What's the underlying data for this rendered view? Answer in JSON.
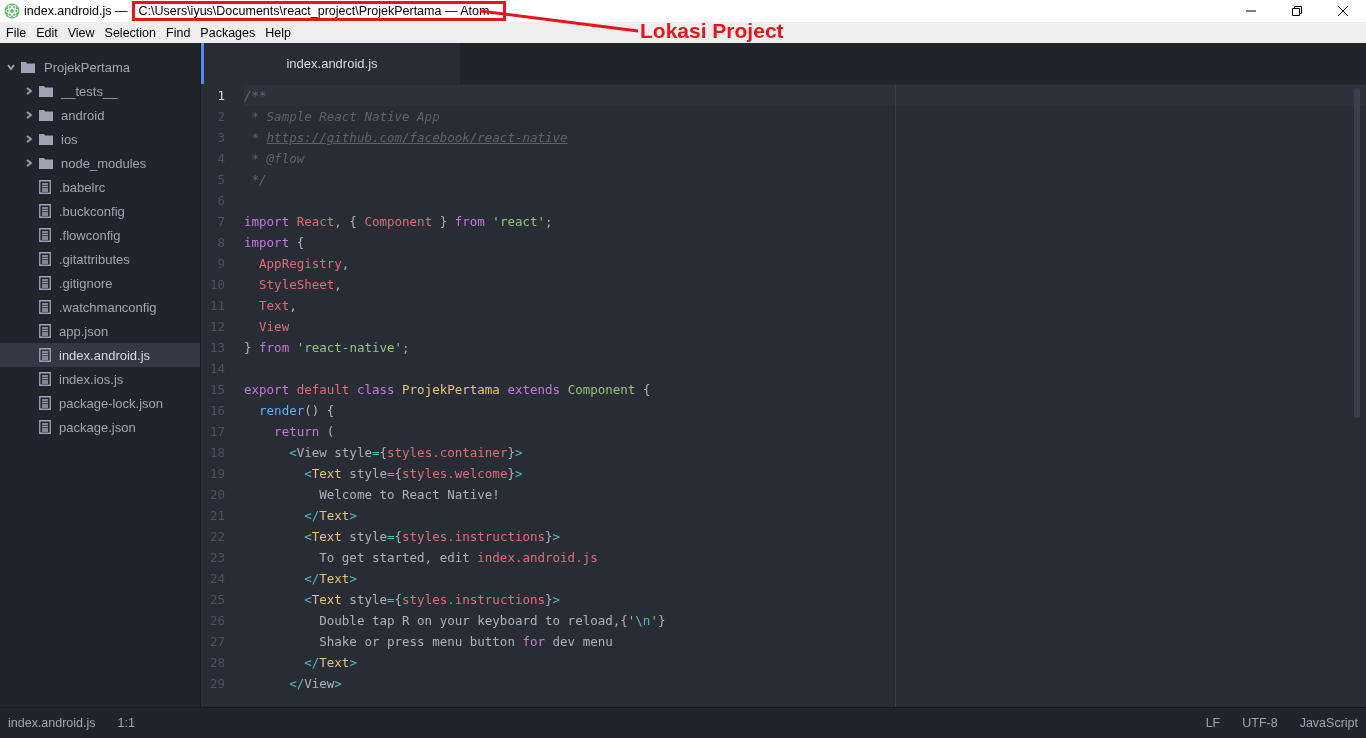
{
  "window": {
    "file_title": "index.android.js —",
    "path_title": "C:\\Users\\iyus\\Documents\\react_project\\ProjekPertama — Atom"
  },
  "annotation": {
    "label": "Lokasi Project"
  },
  "menu": [
    "File",
    "Edit",
    "View",
    "Selection",
    "Find",
    "Packages",
    "Help"
  ],
  "tree": {
    "name": "ProjekPertama",
    "expanded": true,
    "children": [
      {
        "name": "__tests__",
        "kind": "folder",
        "expanded": false,
        "selected": false
      },
      {
        "name": "android",
        "kind": "folder",
        "expanded": false,
        "selected": false
      },
      {
        "name": "ios",
        "kind": "folder",
        "expanded": false,
        "selected": false
      },
      {
        "name": "node_modules",
        "kind": "folder",
        "expanded": false,
        "selected": false
      },
      {
        "name": ".babelrc",
        "kind": "file",
        "selected": false
      },
      {
        "name": ".buckconfig",
        "kind": "file",
        "selected": false
      },
      {
        "name": ".flowconfig",
        "kind": "file",
        "selected": false
      },
      {
        "name": ".gitattributes",
        "kind": "file",
        "selected": false
      },
      {
        "name": ".gitignore",
        "kind": "file",
        "selected": false
      },
      {
        "name": ".watchmanconfig",
        "kind": "file",
        "selected": false
      },
      {
        "name": "app.json",
        "kind": "file",
        "selected": false
      },
      {
        "name": "index.android.js",
        "kind": "file",
        "selected": true
      },
      {
        "name": "index.ios.js",
        "kind": "file",
        "selected": false
      },
      {
        "name": "package-lock.json",
        "kind": "file",
        "selected": false
      },
      {
        "name": "package.json",
        "kind": "file",
        "selected": false
      }
    ]
  },
  "tabs": [
    {
      "label": "index.android.js",
      "selected": true
    }
  ],
  "code": [
    {
      "num": "1",
      "current": true,
      "tokens": [
        {
          "kind": "comment",
          "text": "/**"
        }
      ]
    },
    {
      "num": "2",
      "current": false,
      "tokens": [
        {
          "kind": "comment",
          "text": " * Sample React Native App"
        }
      ]
    },
    {
      "num": "3",
      "current": false,
      "tokens": [
        {
          "kind": "comment",
          "text": " * "
        },
        {
          "kind": "link",
          "text": "https://github.com/facebook/react-native"
        }
      ]
    },
    {
      "num": "4",
      "current": false,
      "tokens": [
        {
          "kind": "comment",
          "text": " * @flow"
        }
      ]
    },
    {
      "num": "5",
      "current": false,
      "tokens": [
        {
          "kind": "comment",
          "text": " */"
        }
      ]
    },
    {
      "num": "6",
      "current": false
    },
    {
      "num": "7",
      "current": false,
      "tokens": [
        {
          "kind": "keyword",
          "text": "import"
        },
        {
          "kind": "variable",
          "text": " React"
        },
        {
          "kind": "plain",
          "text": ", { "
        },
        {
          "kind": "variable",
          "text": "Component"
        },
        {
          "kind": "plain",
          "text": " } "
        },
        {
          "kind": "keyword",
          "text": "from"
        },
        {
          "kind": "string",
          "text": " 'react'"
        },
        {
          "kind": "plain",
          "text": ";"
        }
      ]
    },
    {
      "num": "8",
      "current": false,
      "tokens": [
        {
          "kind": "keyword",
          "text": "import"
        },
        {
          "kind": "plain",
          "text": " {"
        }
      ]
    },
    {
      "num": "9",
      "current": false,
      "tokens": [
        {
          "kind": "variable",
          "text": "  AppRegistry"
        },
        {
          "kind": "plain",
          "text": ","
        }
      ]
    },
    {
      "num": "10",
      "current": false,
      "tokens": [
        {
          "kind": "variable",
          "text": "  StyleSheet"
        },
        {
          "kind": "plain",
          "text": ","
        }
      ]
    },
    {
      "num": "11",
      "current": false,
      "tokens": [
        {
          "kind": "variable",
          "text": "  Text"
        },
        {
          "kind": "plain",
          "text": ","
        }
      ]
    },
    {
      "num": "12",
      "current": false,
      "tokens": [
        {
          "kind": "variable",
          "text": "  View"
        }
      ]
    },
    {
      "num": "13",
      "current": false,
      "tokens": [
        {
          "kind": "plain",
          "text": "} "
        },
        {
          "kind": "keyword",
          "text": "from"
        },
        {
          "kind": "string",
          "text": " 'react-native'"
        },
        {
          "kind": "plain",
          "text": ";"
        }
      ]
    },
    {
      "num": "14",
      "current": false
    },
    {
      "num": "15",
      "current": false,
      "tokens": [
        {
          "kind": "keyword",
          "text": "export"
        },
        {
          "kind": "variable",
          "text": " default"
        },
        {
          "kind": "keyword",
          "text": " class"
        },
        {
          "kind": "class",
          "text": " ProjekPertama"
        },
        {
          "kind": "keyword",
          "text": " extends"
        },
        {
          "kind": "string",
          "text": " Component"
        },
        {
          "kind": "plain",
          "text": " {"
        }
      ]
    },
    {
      "num": "16",
      "current": false,
      "tokens": [
        {
          "kind": "function",
          "text": "  render"
        },
        {
          "kind": "plain",
          "text": "() {"
        }
      ]
    },
    {
      "num": "17",
      "current": false,
      "tokens": [
        {
          "kind": "keyword",
          "text": "    return"
        },
        {
          "kind": "plain",
          "text": " ("
        }
      ]
    },
    {
      "num": "18",
      "current": false,
      "tokens": [
        {
          "kind": "punctuation",
          "text": "      <"
        },
        {
          "kind": "plain",
          "text": "View style"
        },
        {
          "kind": "punctuation",
          "text": "="
        },
        {
          "kind": "plain",
          "text": "{"
        },
        {
          "kind": "variable",
          "text": "styles.container"
        },
        {
          "kind": "plain",
          "text": "}"
        },
        {
          "kind": "punctuation",
          "text": ">"
        }
      ]
    },
    {
      "num": "19",
      "current": false,
      "tokens": [
        {
          "kind": "punctuation",
          "text": "        <"
        },
        {
          "kind": "class",
          "text": "Text"
        },
        {
          "kind": "plain",
          "text": " style"
        },
        {
          "kind": "punctuation",
          "text": "="
        },
        {
          "kind": "plain",
          "text": "{"
        },
        {
          "kind": "variable",
          "text": "styles.welcome"
        },
        {
          "kind": "plain",
          "text": "}"
        },
        {
          "kind": "punctuation",
          "text": ">"
        }
      ]
    },
    {
      "num": "20",
      "current": false,
      "tokens": [
        {
          "kind": "plain",
          "text": "          Welcome to React Native!"
        }
      ]
    },
    {
      "num": "21",
      "current": false,
      "tokens": [
        {
          "kind": "punctuation",
          "text": "        </"
        },
        {
          "kind": "class",
          "text": "Text"
        },
        {
          "kind": "punctuation",
          "text": ">"
        }
      ]
    },
    {
      "num": "22",
      "current": false,
      "tokens": [
        {
          "kind": "punctuation",
          "text": "        <"
        },
        {
          "kind": "class",
          "text": "Text"
        },
        {
          "kind": "plain",
          "text": " style"
        },
        {
          "kind": "punctuation",
          "text": "="
        },
        {
          "kind": "plain",
          "text": "{"
        },
        {
          "kind": "variable",
          "text": "styles.instructions"
        },
        {
          "kind": "plain",
          "text": "}"
        },
        {
          "kind": "punctuation",
          "text": ">"
        }
      ]
    },
    {
      "num": "23",
      "current": false,
      "tokens": [
        {
          "kind": "plain",
          "text": "          To get started, edit "
        },
        {
          "kind": "variable",
          "text": "index.android.js"
        }
      ]
    },
    {
      "num": "24",
      "current": false,
      "tokens": [
        {
          "kind": "punctuation",
          "text": "        </"
        },
        {
          "kind": "class",
          "text": "Text"
        },
        {
          "kind": "punctuation",
          "text": ">"
        }
      ]
    },
    {
      "num": "25",
      "current": false,
      "tokens": [
        {
          "kind": "punctuation",
          "text": "        <"
        },
        {
          "kind": "class",
          "text": "Text"
        },
        {
          "kind": "plain",
          "text": " style"
        },
        {
          "kind": "punctuation",
          "text": "="
        },
        {
          "kind": "plain",
          "text": "{"
        },
        {
          "kind": "variable",
          "text": "styles.instructions"
        },
        {
          "kind": "plain",
          "text": "}"
        },
        {
          "kind": "punctuation",
          "text": ">"
        }
      ]
    },
    {
      "num": "26",
      "current": false,
      "tokens": [
        {
          "kind": "plain",
          "text": "          Double tap R on your keyboard to reload,{"
        },
        {
          "kind": "string",
          "text": "'"
        },
        {
          "kind": "punctuation",
          "text": "\\n"
        },
        {
          "kind": "string",
          "text": "'"
        },
        {
          "kind": "plain",
          "text": "}"
        }
      ]
    },
    {
      "num": "27",
      "current": false,
      "tokens": [
        {
          "kind": "plain",
          "text": "          Shake or press menu button "
        },
        {
          "kind": "keyword",
          "text": "for"
        },
        {
          "kind": "plain",
          "text": " dev menu"
        }
      ]
    },
    {
      "num": "28",
      "current": false,
      "tokens": [
        {
          "kind": "punctuation",
          "text": "        </"
        },
        {
          "kind": "class",
          "text": "Text"
        },
        {
          "kind": "punctuation",
          "text": ">"
        }
      ]
    },
    {
      "num": "29",
      "current": false,
      "tokens": [
        {
          "kind": "punctuation",
          "text": "      </"
        },
        {
          "kind": "plain",
          "text": "View"
        },
        {
          "kind": "punctuation",
          "text": ">"
        }
      ]
    }
  ],
  "status_bar": {
    "file": "index.android.js",
    "cursor": "1:1",
    "line_ending": "LF",
    "encoding": "UTF-8",
    "grammar": "JavaScript"
  }
}
